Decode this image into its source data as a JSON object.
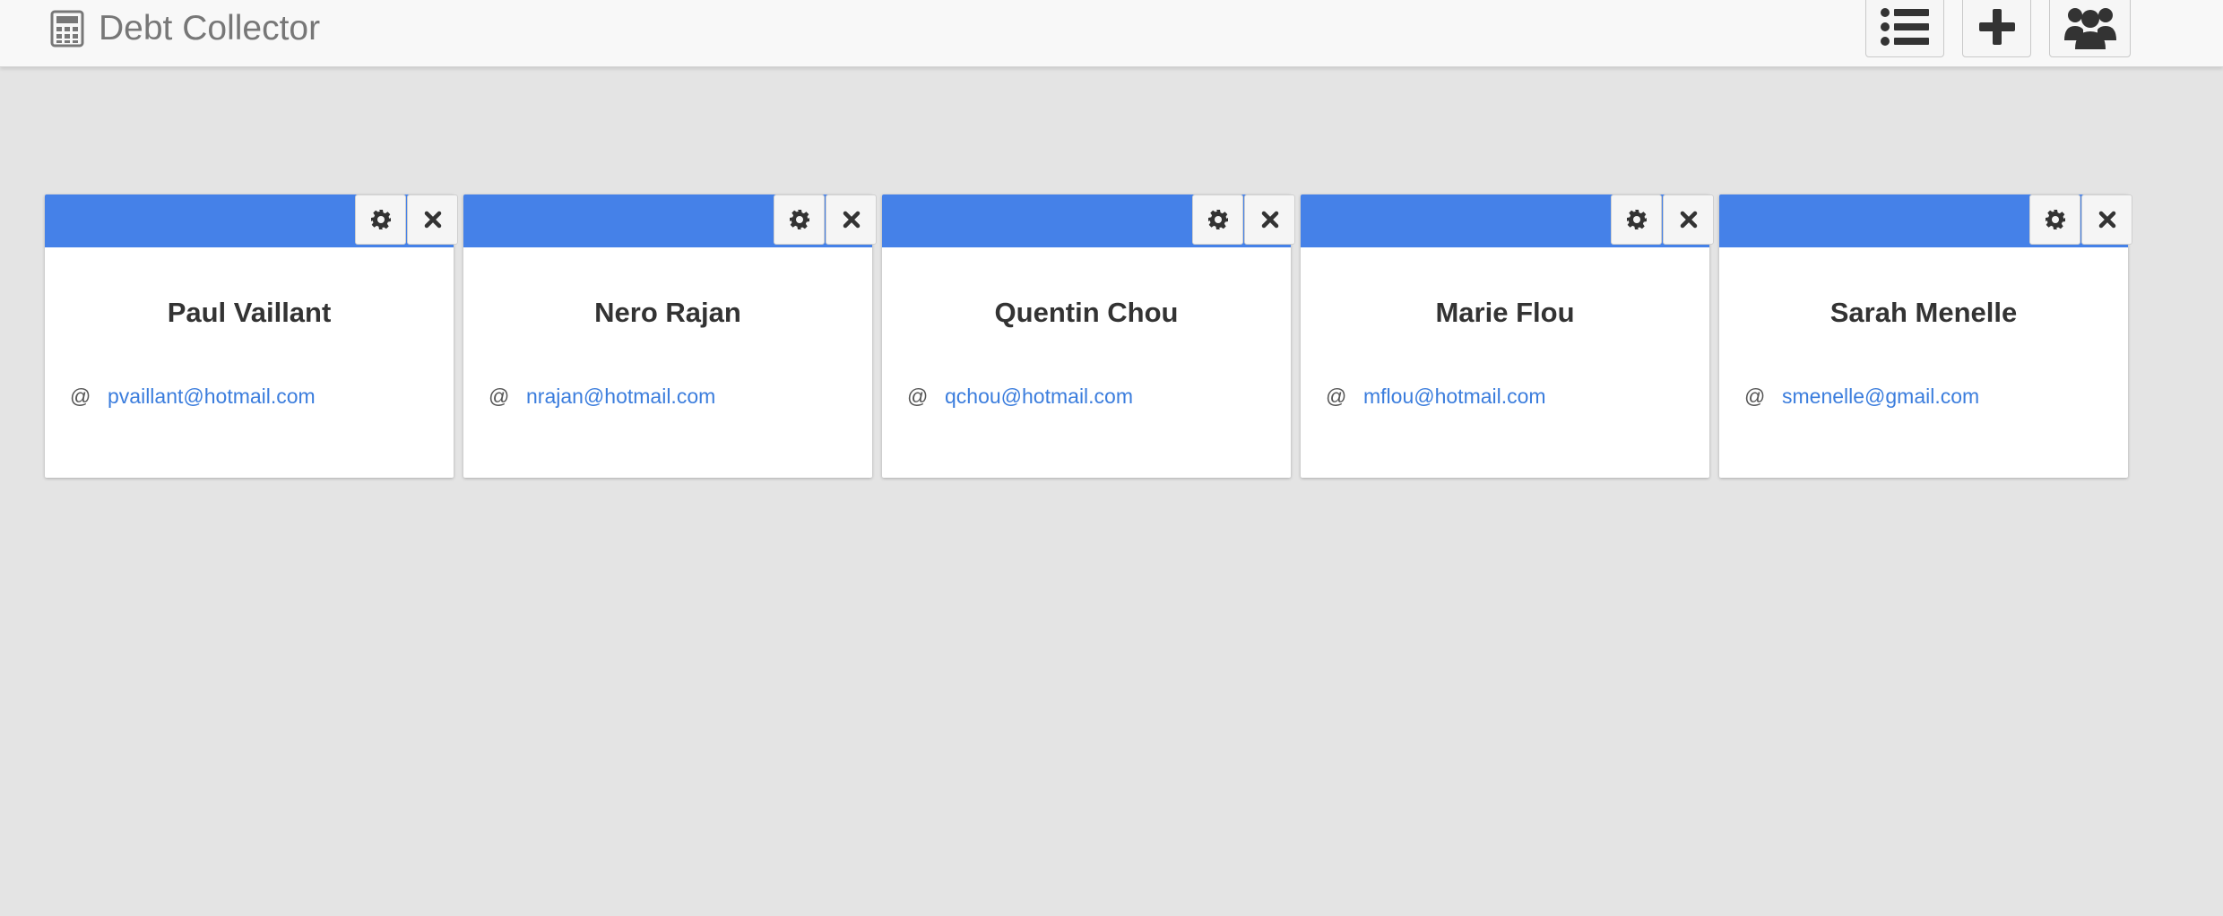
{
  "app": {
    "title": "Debt Collector",
    "brand_icon": "calculator-icon"
  },
  "navbar": {
    "buttons": [
      {
        "name": "list-button",
        "icon": "list-icon"
      },
      {
        "name": "add-button",
        "icon": "plus-icon"
      },
      {
        "name": "users-button",
        "icon": "users-icon"
      }
    ]
  },
  "colors": {
    "accent": "#4581e8",
    "link": "#3b7ddd",
    "background": "#e4e4e4"
  },
  "cards": [
    {
      "name": "Paul Vaillant",
      "at": "@",
      "email": "pvaillant@hotmail.com"
    },
    {
      "name": "Nero Rajan",
      "at": "@",
      "email": "nrajan@hotmail.com"
    },
    {
      "name": "Quentin Chou",
      "at": "@",
      "email": "qchou@hotmail.com"
    },
    {
      "name": "Marie Flou",
      "at": "@",
      "email": "mflou@hotmail.com"
    },
    {
      "name": "Sarah Menelle",
      "at": "@",
      "email": "smenelle@gmail.com"
    }
  ]
}
